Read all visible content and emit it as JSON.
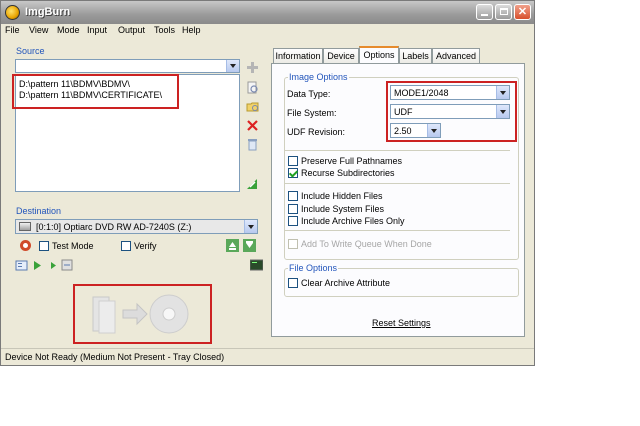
{
  "window": {
    "title": "ImgBurn"
  },
  "menu": [
    "File",
    "View",
    "Mode",
    "Input",
    "Output",
    "Tools",
    "Help"
  ],
  "source": {
    "label": "Source",
    "dropdown_value": "",
    "files": [
      "D:\\pattern 11\\BDMV\\BDMV\\",
      "D:\\pattern 11\\BDMV\\CERTIFICATE\\"
    ]
  },
  "destination": {
    "label": "Destination",
    "drive": "[0:1:0] Optiarc DVD RW AD-7240S (Z:)",
    "test_mode_label": "Test Mode",
    "verify_label": "Verify"
  },
  "tabs": [
    "Information",
    "Device",
    "Options",
    "Labels",
    "Advanced"
  ],
  "active_tab": "Options",
  "image_options": {
    "label": "Image Options",
    "data_type_label": "Data Type:",
    "data_type_value": "MODE1/2048",
    "file_system_label": "File System:",
    "file_system_value": "UDF",
    "udf_revision_label": "UDF Revision:",
    "udf_revision_value": "2.50",
    "checkboxes": [
      {
        "label": "Preserve Full Pathnames",
        "checked": false
      },
      {
        "label": "Recurse Subdirectories",
        "checked": true
      },
      {
        "label": "Include Hidden Files",
        "checked": false
      },
      {
        "label": "Include System Files",
        "checked": false
      },
      {
        "label": "Include Archive Files Only",
        "checked": false
      },
      {
        "label": "Add To Write Queue When Done",
        "checked": false,
        "disabled": true
      }
    ]
  },
  "file_options": {
    "label": "File Options",
    "clear_archive_label": "Clear Archive Attribute"
  },
  "reset_settings_label": "Reset Settings",
  "status": "Device Not Ready (Medium Not Present - Tray Closed)",
  "colors": {
    "highlight": "#cc2222",
    "group_label": "#2255bb",
    "tab_accent": "#e68b2c"
  }
}
